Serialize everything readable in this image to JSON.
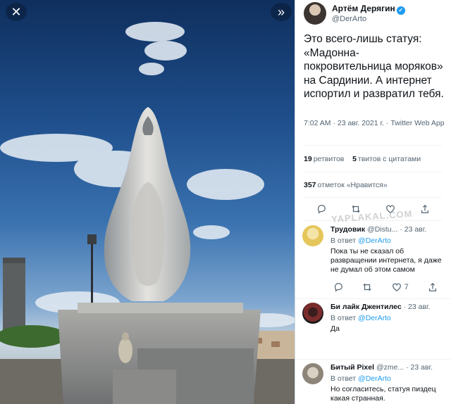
{
  "viewer": {
    "close_icon": "close-icon",
    "collapse_icon": "chevrons-right-icon"
  },
  "tweet": {
    "author_name": "Артём Дерягин",
    "author_handle": "@DerArto",
    "text": "Это всего-лишь статуя: «Мадонна-покровительница моряков» на Сардинии. А интернет испортил и развратил тебя.",
    "meta": "7:02 AM · 23 авг. 2021 г. · Twitter Web App",
    "retweets_count": "19",
    "retweets_label": "ретвитов",
    "quotes_count": "5",
    "quotes_label": "твитов с цитатами",
    "likes_count": "357",
    "likes_label": "отметок «Нравится»"
  },
  "replies": [
    {
      "name": "Трудовик",
      "handle": "@Distu...",
      "time": "· 23 авг.",
      "reply_prefix": "В ответ",
      "reply_to": "@DerArto",
      "text": "Пока ты не сказал об развращении интернета, я даже не думал об этом самом",
      "likes": "7"
    },
    {
      "name": "Би лайк Джентилес",
      "handle": "",
      "time": "· 23 авг.",
      "reply_prefix": "В ответ",
      "reply_to": "@DerArto",
      "text": "Да"
    },
    {
      "name": "Битый Pixel",
      "handle": "@zme...",
      "time": "· 23 авг.",
      "reply_prefix": "В ответ",
      "reply_to": "@DerArto",
      "text": "Но согласитесь, статуя пиздец какая странная."
    }
  ],
  "watermark": "YAPLAKAL.COM",
  "colors": {
    "accent": "#1d9bf0",
    "secondary_text": "#536471"
  }
}
